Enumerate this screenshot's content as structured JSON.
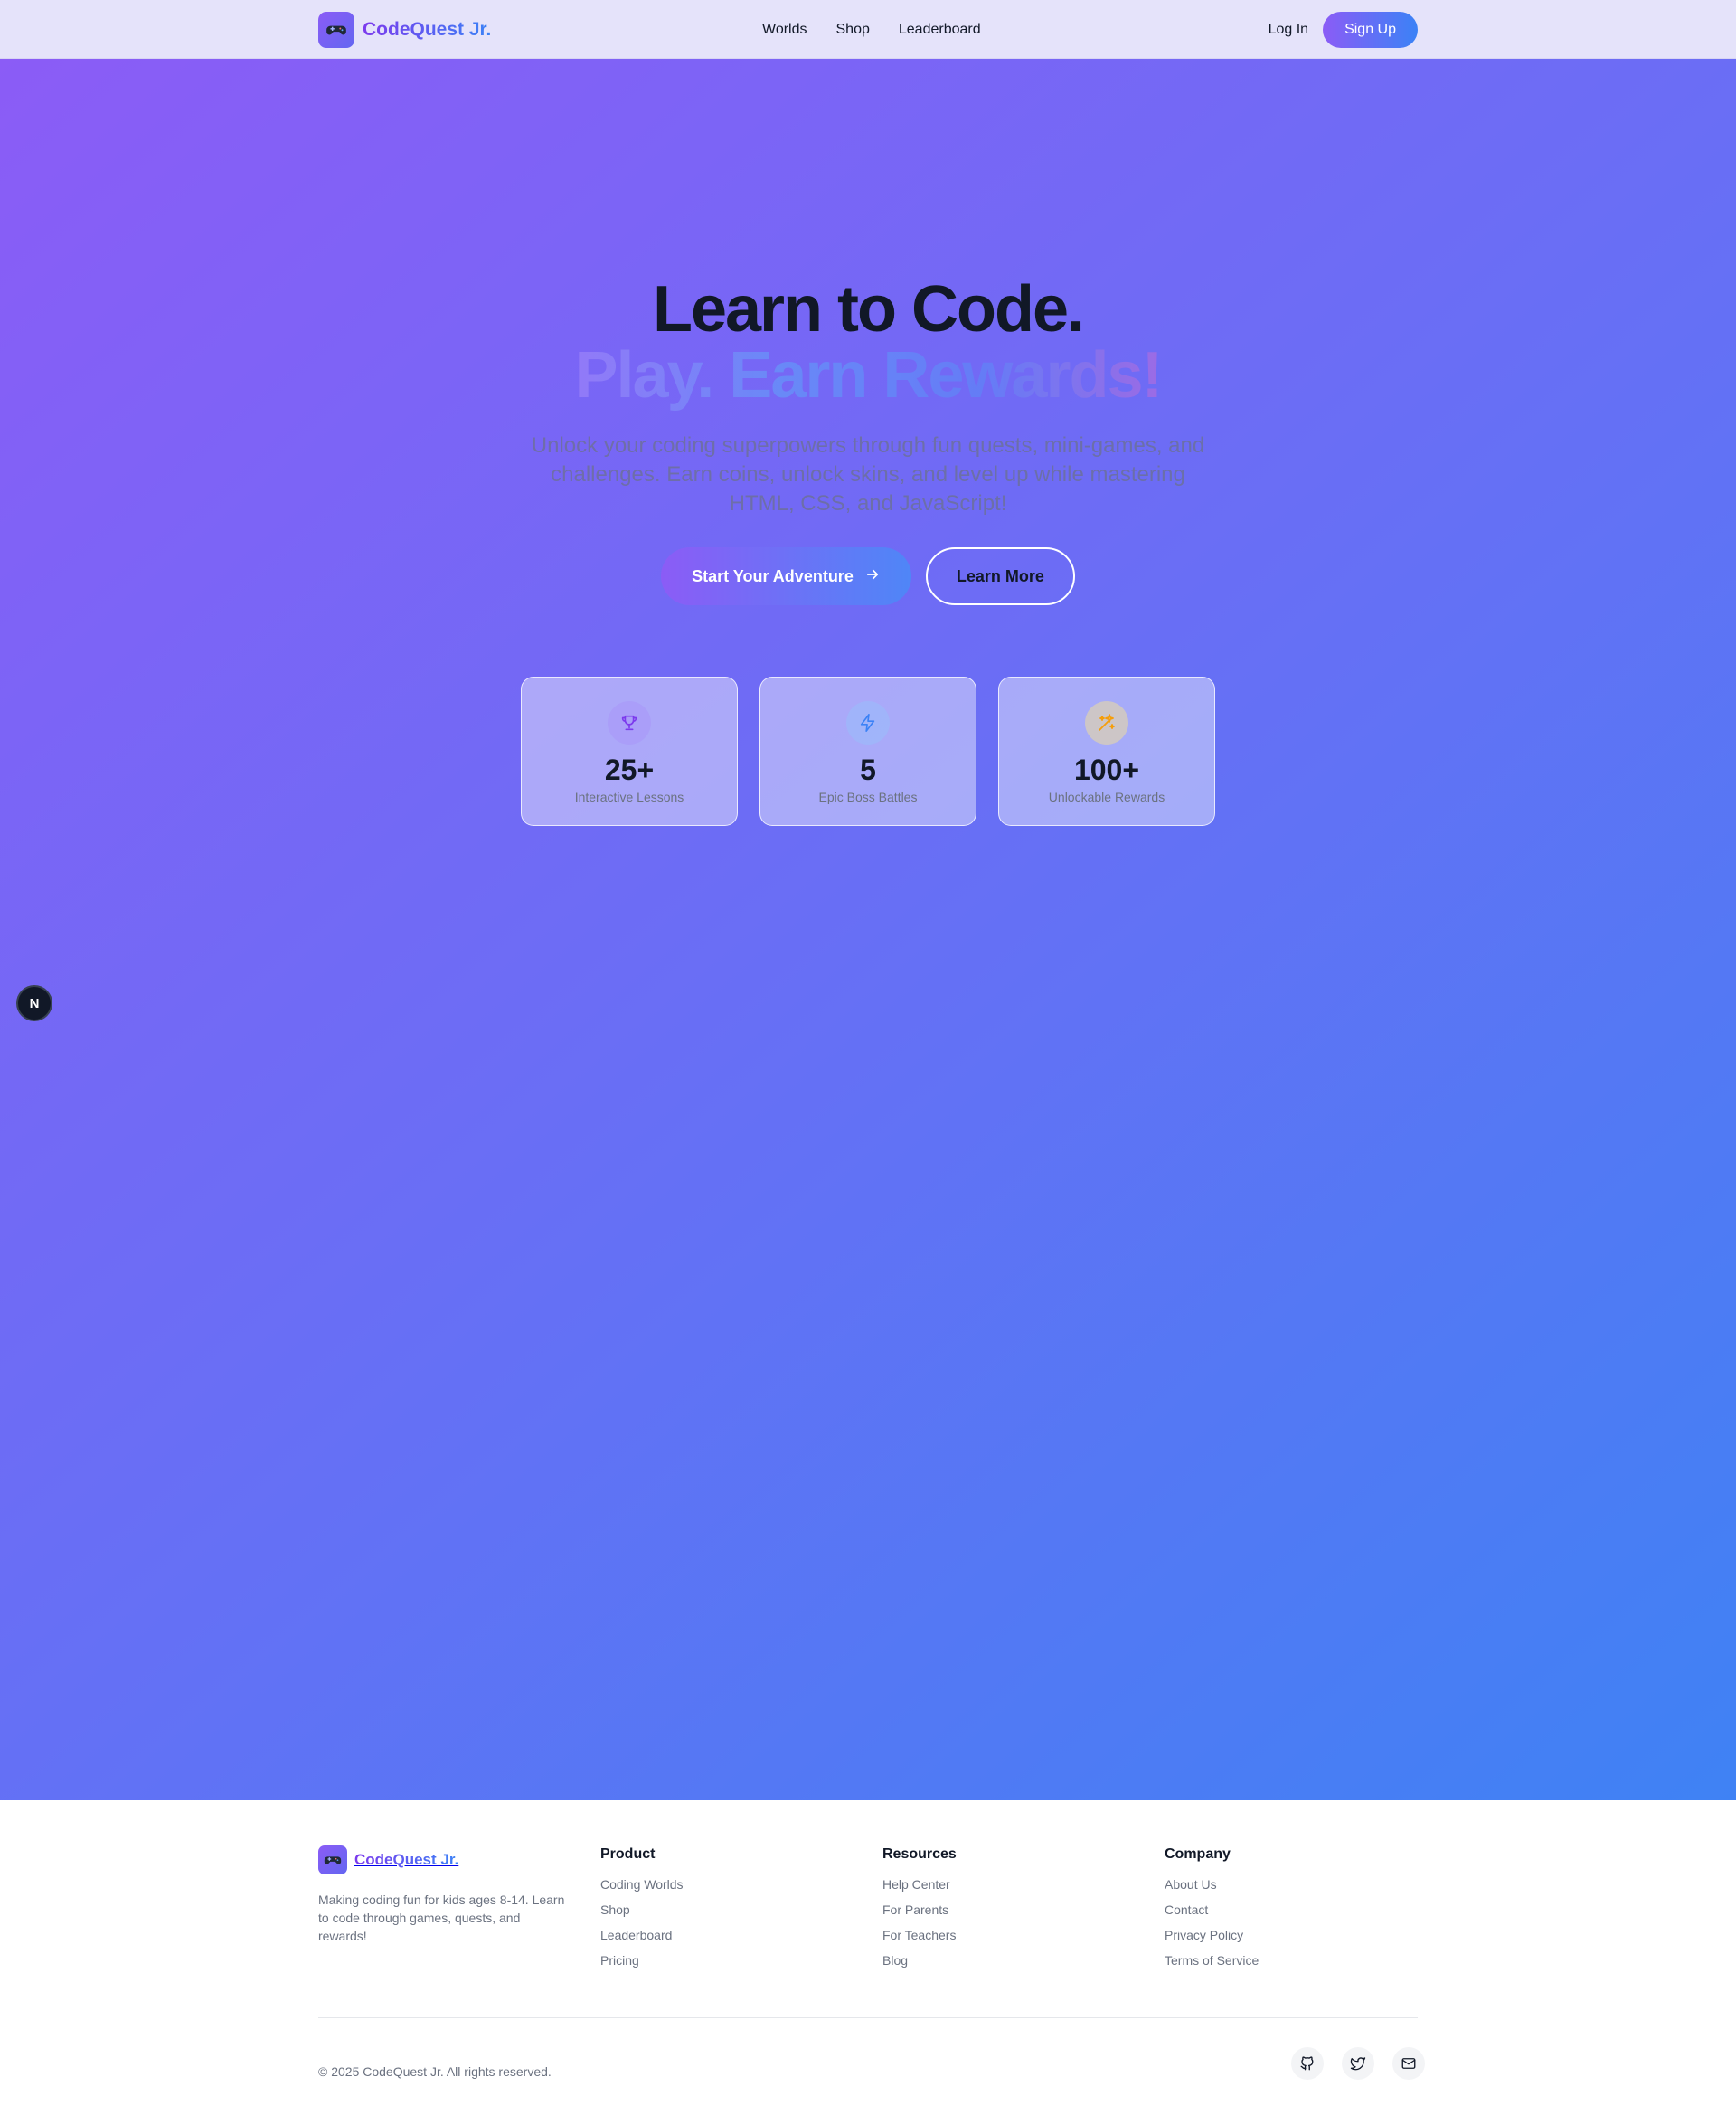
{
  "header": {
    "brand": "CodeQuest Jr.",
    "logo_icon": "gamepad-icon",
    "nav": [
      "Worlds",
      "Shop",
      "Leaderboard"
    ],
    "login": "Log In",
    "signup": "Sign Up"
  },
  "hero": {
    "title_line1": "Learn to Code.",
    "title_line2": "Play. Earn Rewards!",
    "subtitle": "Unlock your coding superpowers through fun quests, mini-games, and challenges. Earn coins, unlock skins, and level up while mastering HTML, CSS, and JavaScript!",
    "primary_cta": "Start Your Adventure",
    "secondary_cta": "Learn More",
    "stats": [
      {
        "icon": "trophy-icon",
        "value": "25+",
        "label": "Interactive Lessons"
      },
      {
        "icon": "lightning-icon",
        "value": "5",
        "label": "Epic Boss Battles"
      },
      {
        "icon": "sparkles-icon",
        "value": "100+",
        "label": "Unlockable Rewards"
      }
    ]
  },
  "dev_badge": "N",
  "footer": {
    "brand": "CodeQuest Jr.",
    "description": "Making coding fun for kids ages 8-14. Learn to code through games, quests, and rewards!",
    "columns": [
      {
        "title": "Product",
        "links": [
          "Coding Worlds",
          "Shop",
          "Leaderboard",
          "Pricing"
        ]
      },
      {
        "title": "Resources",
        "links": [
          "Help Center",
          "For Parents",
          "For Teachers",
          "Blog"
        ]
      },
      {
        "title": "Company",
        "links": [
          "About Us",
          "Contact",
          "Privacy Policy",
          "Terms of Service"
        ]
      }
    ],
    "copyright": "© 2025 CodeQuest Jr. All rights reserved.",
    "socials": [
      "github-icon",
      "twitter-icon",
      "mail-icon"
    ]
  },
  "colors": {
    "brand_purple": "#8b5cf6",
    "brand_blue": "#3b82f6",
    "text_dark": "#111827",
    "text_muted": "#6b7280"
  }
}
